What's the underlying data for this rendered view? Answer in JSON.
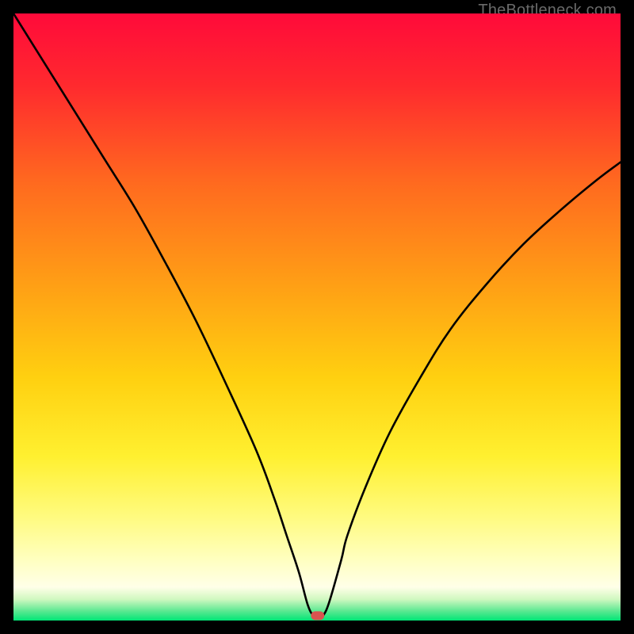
{
  "attribution": "TheBottleneck.com",
  "colors": {
    "frame": "#000000",
    "curve": "#000000",
    "marker_fill": "#d9534f",
    "marker_stroke": "#d9534f",
    "gradient_stops": [
      {
        "offset": 0.0,
        "color": "#ff0a3a"
      },
      {
        "offset": 0.12,
        "color": "#ff2a2e"
      },
      {
        "offset": 0.28,
        "color": "#ff6a1f"
      },
      {
        "offset": 0.45,
        "color": "#ffa015"
      },
      {
        "offset": 0.6,
        "color": "#ffd010"
      },
      {
        "offset": 0.73,
        "color": "#fff030"
      },
      {
        "offset": 0.83,
        "color": "#fffb80"
      },
      {
        "offset": 0.9,
        "color": "#ffffc0"
      },
      {
        "offset": 0.945,
        "color": "#ffffe8"
      },
      {
        "offset": 0.965,
        "color": "#d0f8c0"
      },
      {
        "offset": 0.985,
        "color": "#58e890"
      },
      {
        "offset": 1.0,
        "color": "#00e676"
      }
    ]
  },
  "chart_data": {
    "type": "line",
    "title": "",
    "xlabel": "",
    "ylabel": "",
    "xlim": [
      0,
      100
    ],
    "ylim": [
      0,
      100
    ],
    "grid": false,
    "legend": false,
    "series": [
      {
        "name": "bottleneck-curve",
        "x": [
          0,
          5,
          10,
          15,
          20,
          25,
          30,
          35,
          40,
          43,
          45,
          47,
          48.5,
          49.5,
          50.5,
          51,
          52,
          54,
          55,
          58,
          62,
          67,
          72,
          78,
          84,
          90,
          96,
          100
        ],
        "y": [
          100,
          92,
          84,
          76,
          68,
          59,
          49.5,
          39,
          28,
          20,
          14,
          8,
          2.5,
          0.8,
          0.8,
          0.8,
          3,
          10,
          14,
          22,
          31,
          40,
          48,
          55.5,
          62,
          67.5,
          72.5,
          75.5
        ]
      }
    ],
    "marker": {
      "name": "current-point",
      "x_range": [
        49.0,
        51.2
      ],
      "y": 0.8,
      "shape": "pill"
    }
  }
}
